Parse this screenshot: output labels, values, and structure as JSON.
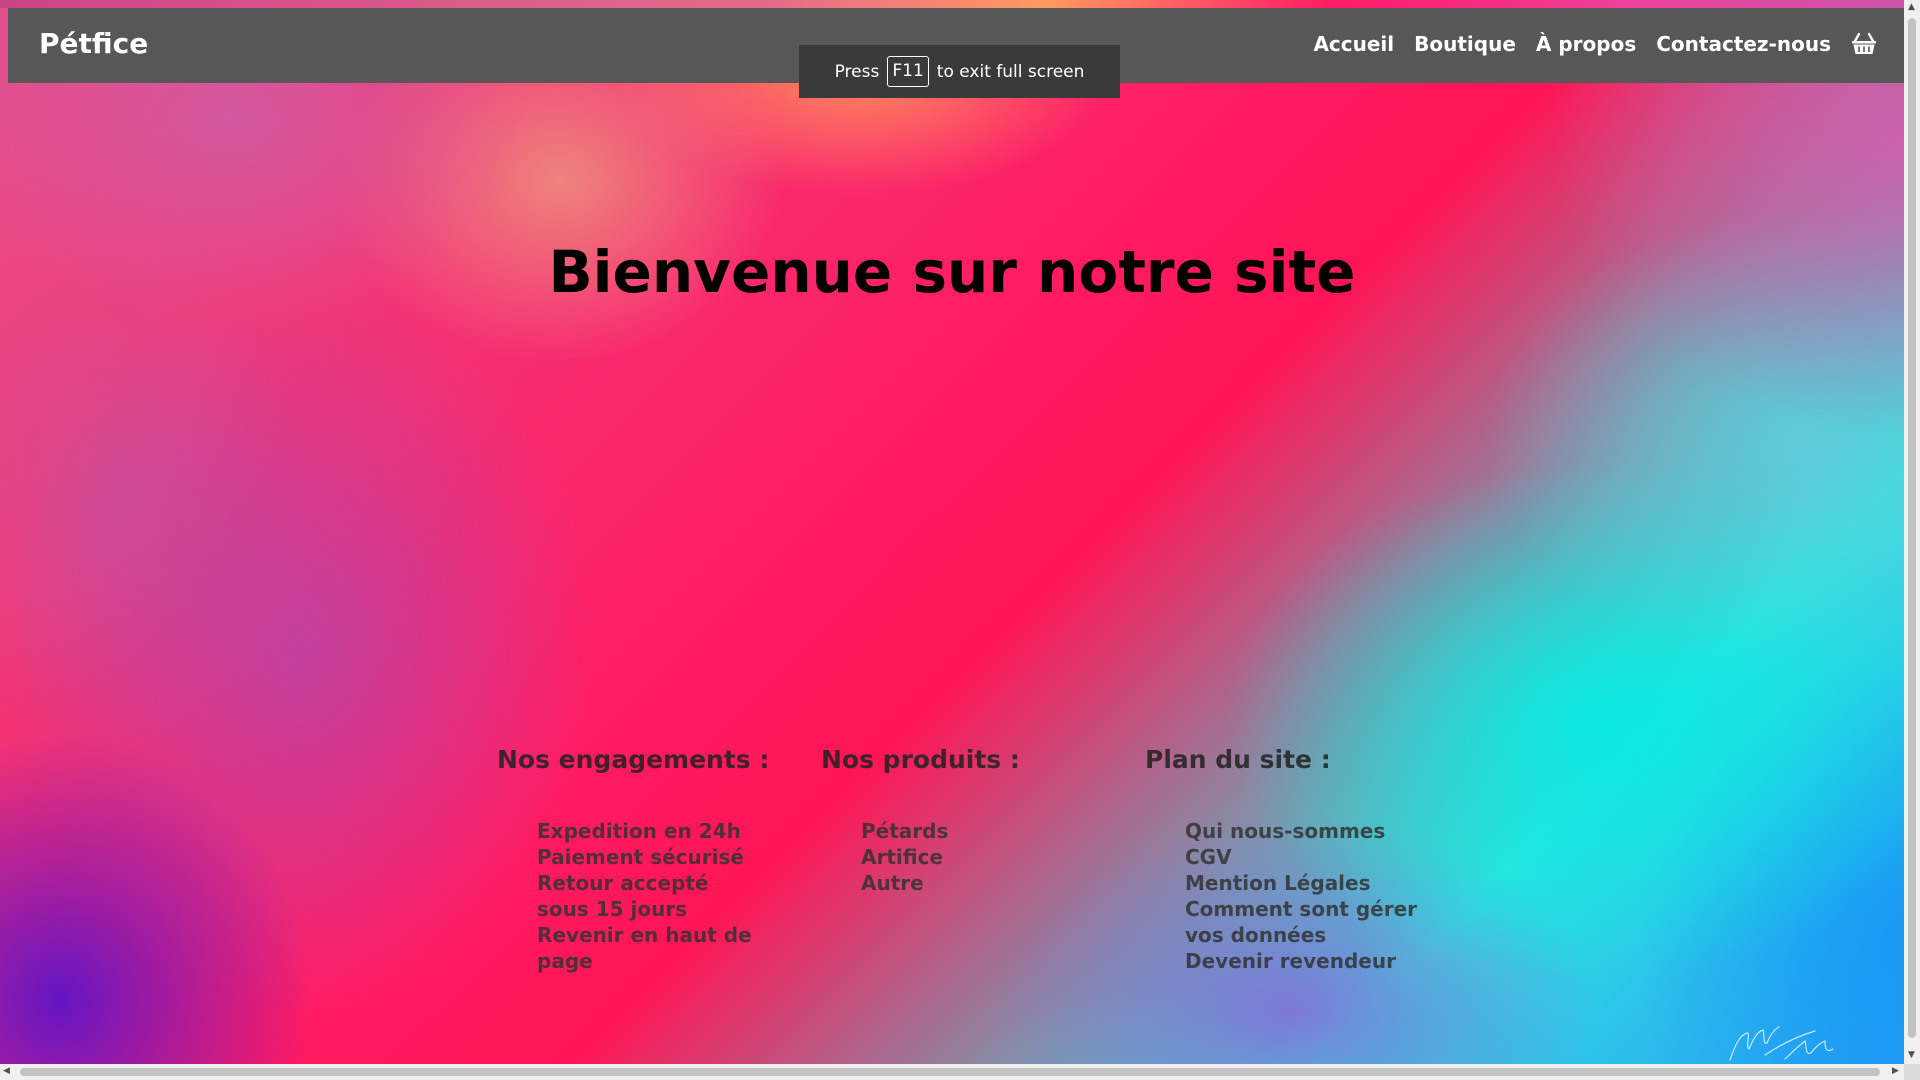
{
  "navbar": {
    "brand": "Pétfice",
    "links": [
      "Accueil",
      "Boutique",
      "À propos",
      "Contactez-nous"
    ],
    "cart_icon": "shopping-basket-icon"
  },
  "fullscreen_notice": {
    "before": "Press",
    "key": "F11",
    "after": "to exit full screen"
  },
  "hero": {
    "title": "Bienvenue sur notre site"
  },
  "footer": {
    "columns": [
      {
        "title": "Nos engagements :",
        "items": [
          "Expedition en 24h",
          "Paiement sécurisé",
          "Retour accepté sous 15 jours",
          "Revenir en haut de page"
        ]
      },
      {
        "title": "Nos produits :",
        "items": [
          "Pétards",
          "Artifice",
          "Autre"
        ]
      },
      {
        "title": "Plan du site :",
        "items": [
          "Qui nous-sommes",
          "CGV",
          "Mention Légales",
          "Comment sont gérer vos données",
          "Devenir revendeur"
        ]
      }
    ]
  },
  "colors": {
    "navbar_bg": "#575757",
    "accent_pink": "#ff1a66",
    "accent_cyan": "#10e8e0",
    "accent_blue": "#2a9cf5",
    "accent_purple": "#5c14c8"
  }
}
